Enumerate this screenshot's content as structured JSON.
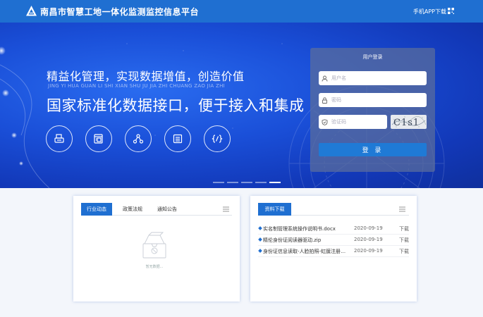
{
  "header": {
    "site_title": "南昌市智慧工地一体化监测监控信息平台",
    "app_download": "手机APP下载"
  },
  "banner": {
    "slogan_main": "精益化管理，实现数据增值，创造价值",
    "slogan_pinyin": "JING YI HUA GUAN LI SHI XIAN SHU JU JIA ZHI CHUANG ZAO JIA ZHI",
    "slogan_sub": "国家标准化数据接口，便于接入和集成",
    "feature_icons": [
      "printer-icon",
      "document-icon",
      "network-icon",
      "list-icon",
      "code-icon"
    ],
    "active_slide": 4,
    "slide_count": 5
  },
  "login": {
    "title": "用户登录",
    "username_placeholder": "用户名",
    "password_placeholder": "密码",
    "captcha_placeholder": "验证码",
    "captcha_text": "C1s1",
    "submit_label": "登 录"
  },
  "news_panel": {
    "tabs": [
      "行业动态",
      "政策法规",
      "通知公告"
    ],
    "active_tab": 0,
    "empty_text": "暂无数据..."
  },
  "downloads_panel": {
    "tab": "资料下载",
    "files": [
      {
        "name": "实名制管理系统操作说明书.docx",
        "date": "2020-09-19",
        "action": "下载"
      },
      {
        "name": "精伦身份证阅读器驱动.zip",
        "date": "2020-09-19",
        "action": "下载"
      },
      {
        "name": "身份证信息读取-人脸拍照-虹膜注册脱...",
        "date": "2020-09-19",
        "action": "下载"
      }
    ]
  },
  "colors": {
    "header": "#1f6fd1",
    "accent": "#1f6fd1",
    "login_button": "#1f7ad6"
  }
}
